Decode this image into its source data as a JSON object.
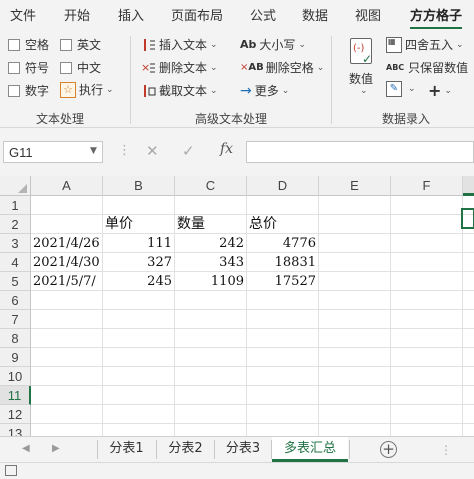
{
  "menu": {
    "items": [
      "文件",
      "开始",
      "插入",
      "页面布局",
      "公式",
      "数据",
      "视图",
      "方方格子"
    ],
    "active": "方方格子"
  },
  "ribbon": {
    "text_processing": {
      "checks": [
        "空格",
        "英文",
        "符号",
        "中文",
        "数字"
      ],
      "execute": "执行",
      "label": "文本处理"
    },
    "advanced": {
      "insert_text": "插入文本",
      "delete_text": "删除文本",
      "cut_text": "截取文本",
      "case": "大小写",
      "delete_spaces": "删除空格",
      "more": "更多",
      "label": "高级文本处理"
    },
    "data_entry": {
      "values": "数值",
      "round": "四舍五入",
      "keep_value": "只保留数值",
      "label": "数据录入"
    }
  },
  "formula_bar": {
    "name_box": "G11",
    "fx": "fx",
    "formula": ""
  },
  "columns": [
    "A",
    "B",
    "C",
    "D",
    "E",
    "F"
  ],
  "rows": [
    "1",
    "2",
    "3",
    "4",
    "5",
    "6",
    "7",
    "8",
    "9",
    "10",
    "11",
    "12",
    "13"
  ],
  "cells": {
    "header": [
      "单价",
      "数量",
      "总价"
    ],
    "data": [
      [
        "2021/4/26",
        "111",
        "242",
        "4776"
      ],
      [
        "2021/4/30",
        "327",
        "343",
        "18831"
      ],
      [
        "2021/5/7/",
        "245",
        "1109",
        "17527"
      ]
    ]
  },
  "sheets": {
    "tabs": [
      "分表1",
      "分表2",
      "分表3",
      "多表汇总"
    ],
    "active": "多表汇总"
  },
  "colors": {
    "accent": "#217346"
  }
}
